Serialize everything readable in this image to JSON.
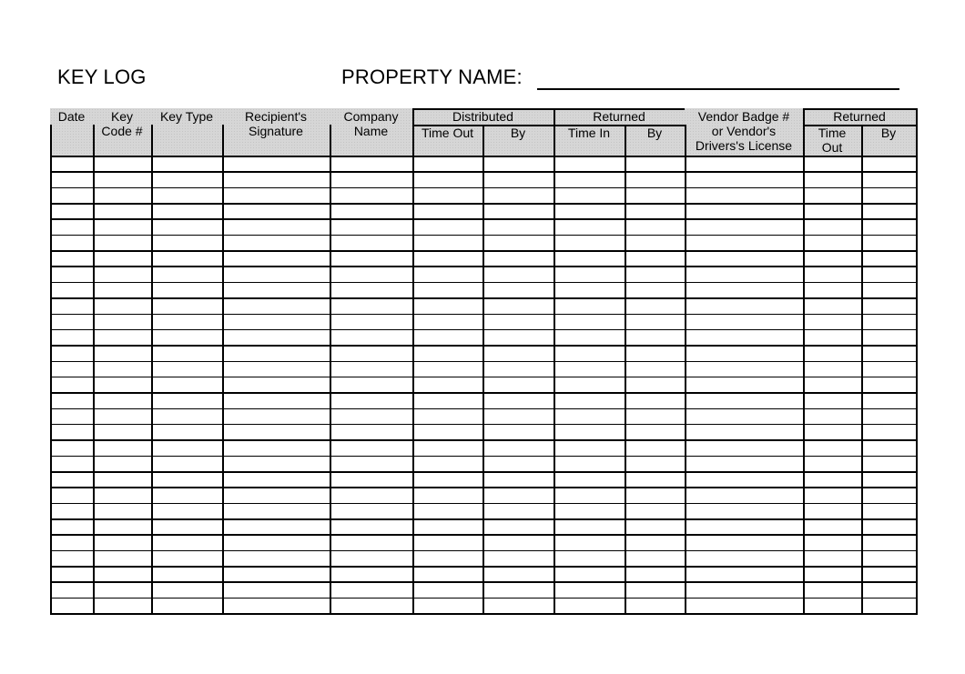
{
  "header": {
    "title": "KEY LOG",
    "property_label": "PROPERTY NAME:",
    "property_value": ""
  },
  "table": {
    "columns": [
      {
        "key": "date",
        "label_line1": "Date",
        "label_line2": ""
      },
      {
        "key": "key_code",
        "label_line1": "Key",
        "label_line2": "Code #"
      },
      {
        "key": "key_type",
        "label_line1": "Key Type",
        "label_line2": ""
      },
      {
        "key": "recipient_signature",
        "label_line1": "Recipient's",
        "label_line2": "Signature"
      },
      {
        "key": "company_name",
        "label_line1": "Company",
        "label_line2": "Name"
      },
      {
        "key": "distributed_time_out",
        "group": "Distributed",
        "label_line1": "Time Out",
        "label_line2": ""
      },
      {
        "key": "distributed_by",
        "group": "Distributed",
        "label_line1": "By",
        "label_line2": ""
      },
      {
        "key": "returned_time_in",
        "group": "Returned",
        "label_line1": "Time In",
        "label_line2": ""
      },
      {
        "key": "returned_by",
        "group": "Returned",
        "label_line1": "By",
        "label_line2": ""
      },
      {
        "key": "vendor_badge",
        "label_line1": "Vendor Badge #",
        "label_line2": "or Vendor's",
        "label_line3": "Drivers's License"
      },
      {
        "key": "returned2_time_out",
        "group": "Returned",
        "label_line1": "Time",
        "label_line2": "Out"
      },
      {
        "key": "returned2_by",
        "group": "Returned",
        "label_line1": "By",
        "label_line2": ""
      }
    ],
    "groups": [
      {
        "label": "Distributed"
      },
      {
        "label": "Returned"
      },
      {
        "label": "Returned"
      }
    ],
    "row_count": 29,
    "rows": []
  }
}
